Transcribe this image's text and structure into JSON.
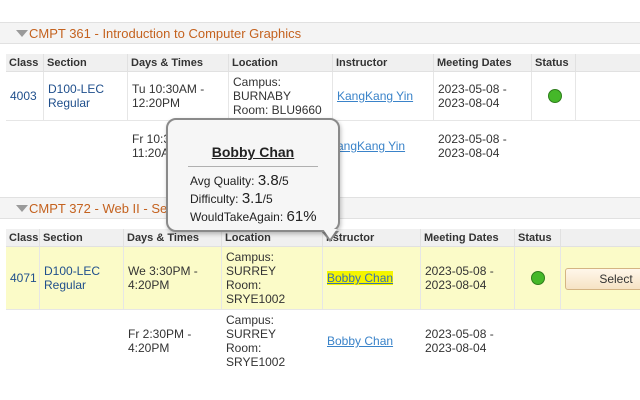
{
  "courses": [
    {
      "title": "CMPT 361 - Introduction to Computer Graphics",
      "columns": [
        "Class",
        "Section",
        "Days & Times",
        "Location",
        "Instructor",
        "Meeting Dates",
        "Status"
      ],
      "rows": [
        {
          "class": "4003",
          "section_line1": "D100-LEC",
          "section_line2": "Regular",
          "times_line1": "Tu 10:30AM -",
          "times_line2": "12:20PM",
          "loc_line1": "Campus:",
          "loc_line2": "BURNABY",
          "loc_line3": "Room: BLU9660",
          "instructor": "KangKang Yin",
          "dates_line1": "2023-05-08 -",
          "dates_line2": "2023-08-04",
          "status": "open"
        },
        {
          "times_line1": "Fr 10:3",
          "times_line2": "11:20A",
          "instructor": "angKang Yin",
          "dates_line1": "2023-05-08 -",
          "dates_line2": "2023-08-04"
        }
      ]
    },
    {
      "title": "CMPT 372 - Web II - Se",
      "columns": [
        "Class",
        "Section",
        "Days & Times",
        "Location",
        "nstructor",
        "Meeting Dates",
        "Status"
      ],
      "rows": [
        {
          "class": "4071",
          "section_line1": "D100-LEC",
          "section_line2": "Regular",
          "times_line1": "We 3:30PM -",
          "times_line2": "4:20PM",
          "loc_line1": "Campus:",
          "loc_line2": "SURREY",
          "loc_line3": "Room:",
          "loc_line4": "SRYE1002",
          "instructor": "Bobby Chan",
          "dates_line1": "2023-05-08 -",
          "dates_line2": "2023-08-04",
          "status": "open",
          "button": "Select"
        },
        {
          "times_line1": "Fr 2:30PM -",
          "times_line2": "4:20PM",
          "loc_line1": "Campus:",
          "loc_line2": "SURREY",
          "loc_line3": "Room:",
          "loc_line4": "SRYE1002",
          "instructor": "Bobby Chan",
          "dates_line1": "2023-05-08 -",
          "dates_line2": "2023-08-04"
        }
      ]
    }
  ],
  "tooltip": {
    "name": "Bobby Chan",
    "quality_label": "Avg Quality:",
    "quality_value": "3.8",
    "quality_suffix": "/5",
    "difficulty_label": "Difficulty:",
    "difficulty_value": "3.1",
    "difficulty_suffix": "/5",
    "again_label": "WouldTakeAgain:",
    "again_value": "61%"
  },
  "colors": {
    "section_title": "#c4621f",
    "highlight_row": "#fbfbc8",
    "status_open": "#45b829"
  },
  "icons": {
    "collapse": "triangle-down-icon",
    "status": "green-circle-icon"
  }
}
